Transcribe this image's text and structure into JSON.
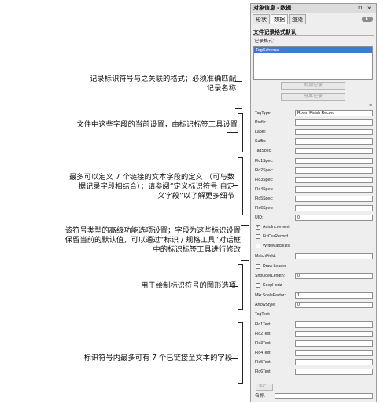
{
  "palette": {
    "title": "对象信息 - 数据",
    "title_pin": "⊓",
    "title_close": "×",
    "tabs": [
      "形状",
      "数据",
      "渲染"
    ],
    "section_header": "文件记录格式默认",
    "record_format_label": "记录格式:",
    "record_list_items": [
      "TagSchema"
    ],
    "attach_record_button": "附加记录",
    "detach_record_button": "分离记录",
    "menu_glyph": "≡",
    "fields": {
      "tag_type_label": "TagType:",
      "tag_type_value": "Room Finish Record",
      "prefix_label": "Prefix:",
      "prefix_value": "",
      "label_label": "Label:",
      "label_value": "",
      "suffix_label": "Suffix:",
      "suffix_value": "",
      "tagspec_label": "TagSpec:",
      "tagspec_value": "",
      "fld_spec": [
        {
          "label": "Fld1Spec:",
          "value": ""
        },
        {
          "label": "Fld2Spec:",
          "value": ""
        },
        {
          "label": "Fld3Spec:",
          "value": ""
        },
        {
          "label": "Fld4Spec:",
          "value": ""
        },
        {
          "label": "Fld5Spec:",
          "value": ""
        },
        {
          "label": "Fld6Spec:",
          "value": ""
        }
      ],
      "uid_label": "UID:",
      "uid_value": "0",
      "auto_increment_label": "AutoIncrement",
      "fix_cur_record_label": "FixCurRecord",
      "write_match_ids_label": "WriteMatchIDs",
      "match_field_label": "MatchField:",
      "match_field_value": "",
      "draw_leader_label": "Draw Leader",
      "shoulder_length_label": "ShoulderLength:",
      "shoulder_length_value": "0",
      "keep_horiz_label": "KeepHoriz",
      "mkr_scale_factor_label": "Mkr.ScaleFactor:",
      "mkr_scale_factor_value": "1",
      "arrow_style_label": "ArrowStyle:",
      "arrow_style_value": "0",
      "tag_text_label": "TagText:",
      "fld_text": [
        {
          "label": "Fld1Text:",
          "value": ""
        },
        {
          "label": "Fld2Text:",
          "value": ""
        },
        {
          "label": "Fld3Text:",
          "value": ""
        },
        {
          "label": "Fld4Text:",
          "value": ""
        },
        {
          "label": "Fld5Text:",
          "value": ""
        },
        {
          "label": "Fld6Text:",
          "value": ""
        }
      ]
    },
    "ifc_button": "IFC...",
    "name_label": "名称:",
    "name_value": ""
  },
  "annotations": [
    "记录标识符号与之关联的格式；必须准确匹配\n记录名称",
    "文件中这些字段的当前设置，由标识标签工具设置",
    "最多可以定义 7 个链接的文本字段的定义 （可与数\n据记录字段相结合）；请参阅“定义标识符号 自定\n义字段”以了解更多细节",
    "该符号类型的高级功能选项设置；字段为这些标识设置\n保留当前的默认值，可以通过“标识 / 规格工具”对话框\n中的标识标签工具进行修改",
    "用于绘制标识符号的图形选项",
    "标识符号内最多可有 7 个已链接至文本的字段"
  ]
}
